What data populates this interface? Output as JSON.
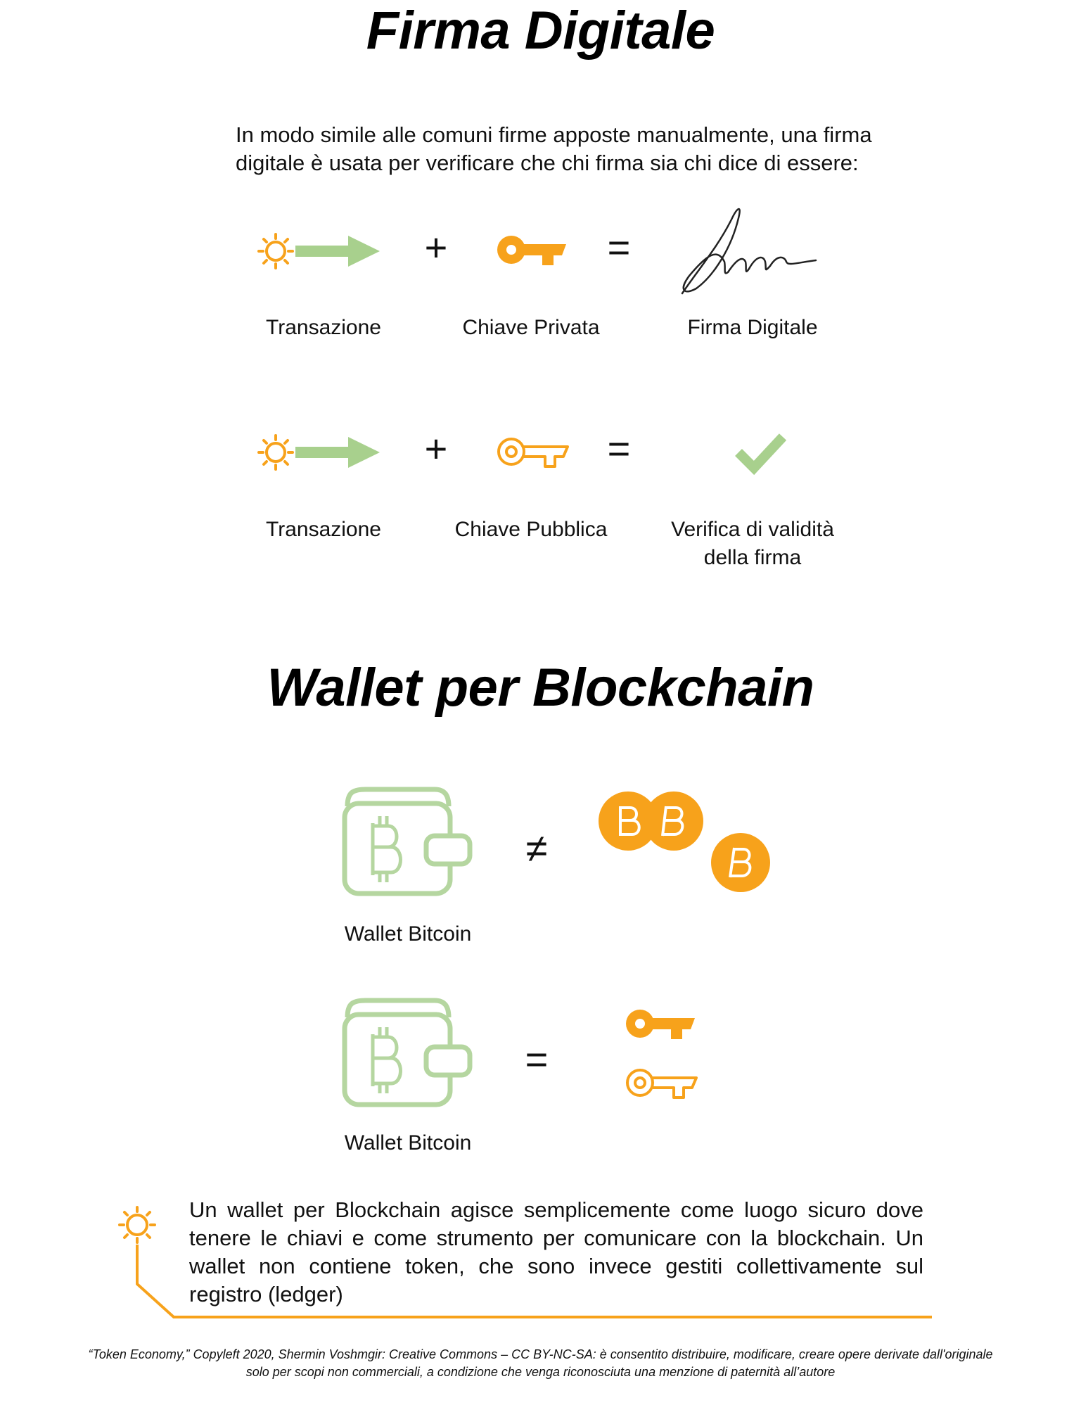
{
  "section1": {
    "title": "Firma Digitale",
    "intro_line1": "In modo simile alle comuni firme apposte manualmente, una firma",
    "intro_line2": "digitale è usata per verificare che chi firma sia chi dice di essere:",
    "row1": {
      "label_transaction": "Transazione",
      "plus": "+",
      "label_key": "Chiave Privata",
      "equals": "=",
      "label_result": "Firma Digitale"
    },
    "row2": {
      "label_transaction": "Transazione",
      "plus": "+",
      "label_key": "Chiave Pubblica",
      "equals": "=",
      "label_result_line1": "Verifica di validità",
      "label_result_line2": "della firma"
    }
  },
  "section2": {
    "title": "Wallet per Blockchain",
    "row1": {
      "wallet_label": "Wallet Bitcoin",
      "operator": "≠"
    },
    "row2": {
      "wallet_label": "Wallet Bitcoin",
      "operator": "="
    },
    "note": "Un wallet per Blockchain agisce semplicemente come luogo sicuro dove tenere le chiavi e come strumento per comunicare con la blockchain. Un wallet non contiene token, che sono invece gestiti collettivamente sul registro (ledger)"
  },
  "footer": {
    "line1": "“Token Economy,” Copyleft 2020, Shermin Voshmgir: Creative Commons – CC BY-NC-SA: è consentito distribuire, modificare, creare opere derivate dall'originale",
    "line2": "solo per scopi non commerciali, a condizione che venga riconosciuta una menzione di paternità all’autore"
  },
  "colors": {
    "orange": "#f7a21b",
    "green": "#a8d08d",
    "wallet_green": "#b5d6a0",
    "text": "#111111"
  },
  "icons": [
    "sun-icon",
    "arrow-icon",
    "solid-key-icon",
    "outline-key-icon",
    "signature-icon",
    "checkmark-icon",
    "wallet-icon",
    "bitcoin-coin-icon"
  ]
}
